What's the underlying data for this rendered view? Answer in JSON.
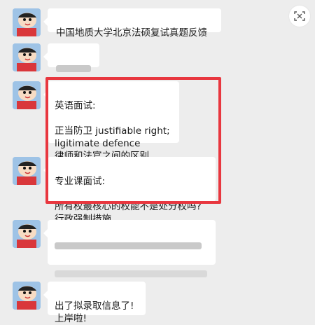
{
  "messages": [
    {
      "text": "中国地质大学北京法硕复试真题反馈"
    },
    {
      "text": ""
    },
    {
      "heading": "英语面试:",
      "body": "正当防卫 justifiable right;\nligitimate defence\n律师和法官之间的区别"
    },
    {
      "heading": "专业课面试:",
      "body": "所有权最核心的权能不是处分权吗?\n行政强制措施"
    },
    {
      "text": ""
    },
    {
      "text": "出了拟录取信息了!\n上岸啦!"
    }
  ],
  "colors": {
    "background": "#ededed",
    "bubble": "#ffffff",
    "highlight": "#e8373f"
  },
  "icons": {
    "avatar": "cartoon-avatar",
    "corner": "scan-icon"
  }
}
